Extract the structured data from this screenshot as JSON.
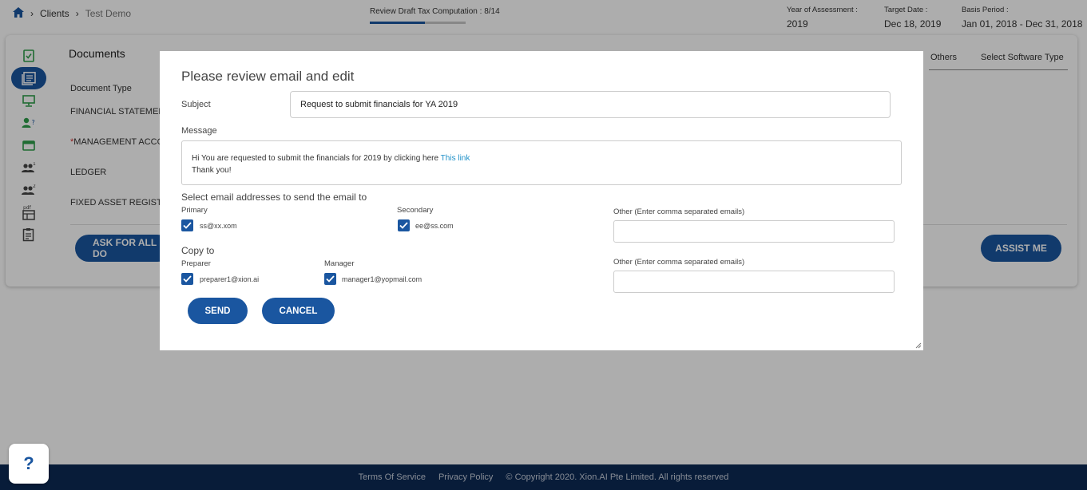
{
  "breadcrumb": {
    "home_icon": "home-icon",
    "clients": "Clients",
    "current": "Test Demo"
  },
  "progress": {
    "label": "Review Draft Tax Computation : 8/14",
    "fraction": 0.571
  },
  "header_info": {
    "year_label": "Year of Assessment :",
    "year_value": "2019",
    "target_label": "Target Date :",
    "target_value": "Dec 18, 2019",
    "basis_label": "Basis Period :",
    "basis_value": "Jan 01, 2018 - Dec 31, 2018"
  },
  "documents": {
    "title": "Documents",
    "column": "Document Type",
    "rows": [
      "FINANCIAL STATEMEN",
      "MANAGEMENT ACCO",
      "LEDGER",
      "FIXED ASSET REGISTE"
    ],
    "required_mark": "*",
    "tabs": [
      "Others",
      "Select Software Type"
    ],
    "ask_button": "ASK FOR ALL DO",
    "assist_button": "ASSIST ME"
  },
  "modal": {
    "title": "Please review email and edit",
    "subject_label": "Subject",
    "subject_value": "Request to submit financials for YA 2019",
    "message_label": "Message",
    "message_line1": "Hi You are requested to submit the financials for 2019 by clicking here ",
    "message_link": "This link",
    "message_line2": "Thank you!",
    "select_heading": "Select email addresses to send the email to",
    "primary_label": "Primary",
    "primary_email": "ss@xx.xom",
    "secondary_label": "Secondary",
    "secondary_email": "ee@ss.com",
    "other_label_1": "Other (Enter comma separated emails)",
    "copy_heading": "Copy to",
    "preparer_label": "Preparer",
    "preparer_email": "preparer1@xion.ai",
    "manager_label": "Manager",
    "manager_email": "manager1@yopmail.com",
    "other_label_2": "Other (Enter comma separated emails)",
    "send_button": "SEND",
    "cancel_button": "CANCEL"
  },
  "footer": {
    "terms": "Terms Of Service",
    "privacy": "Privacy Policy",
    "copyright": "© Copyright 2020. Xion.AI Pte Limited. All rights reserved"
  },
  "help_button": "?",
  "colors": {
    "primary": "#1a56a0",
    "footer": "#0d2a55",
    "link": "#1e90c8",
    "required": "#d32f2f"
  }
}
